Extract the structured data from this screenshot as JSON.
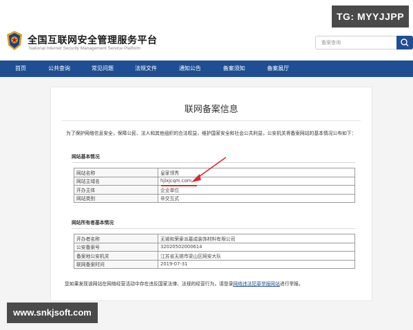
{
  "header": {
    "title": "全国互联网安全管理服务平台",
    "subtitle": "National Internet Security Management Service Platform",
    "search_placeholder": "备案查询"
  },
  "badge": "TG: MYYJJPP",
  "nav": [
    "首页",
    "公共查询",
    "常见问题",
    "法规文件",
    "通知公告",
    "备案须知",
    "备案展厅"
  ],
  "page_title": "联网备案信息",
  "intro": "为了保护网络信息安全，保障公民、法人和其他组织的合法权益，维护国家安全和社会公共利益，公安机关将备案网站的基本情况公布如下：",
  "site_section": {
    "title": "网站基本情况",
    "rows": [
      {
        "key": "网站名称",
        "value": "皇家领秀"
      },
      {
        "key": "网站主域名",
        "value": "hjlxjcqm.com"
      },
      {
        "key": "开办主体",
        "value": "企业单位"
      },
      {
        "key": "网站类别",
        "value": "非交互式"
      }
    ]
  },
  "owner_section": {
    "title": "网站所有者基本情况",
    "rows": [
      {
        "key": "开办者名称",
        "value": "无锡和荣豪派墓成装饰材料有限公司"
      },
      {
        "key": "公安备案号",
        "value": "32020502000614"
      },
      {
        "key": "备案地公安机关",
        "value": "江苏省无锡市梁山区网安大队"
      },
      {
        "key": "联网备案时间",
        "value": "2019-07-31"
      }
    ]
  },
  "footer": {
    "before": "您如果发现该网站在网络经营活动中存在违反国家法律、法规的经营行为，请登录",
    "link": "网络违法犯罪举报网站",
    "after": "进行举报。"
  },
  "watermark": "www.snkjsoft.com",
  "colors": {
    "nav": "#1f4f92",
    "annotation": "#e0262b"
  }
}
